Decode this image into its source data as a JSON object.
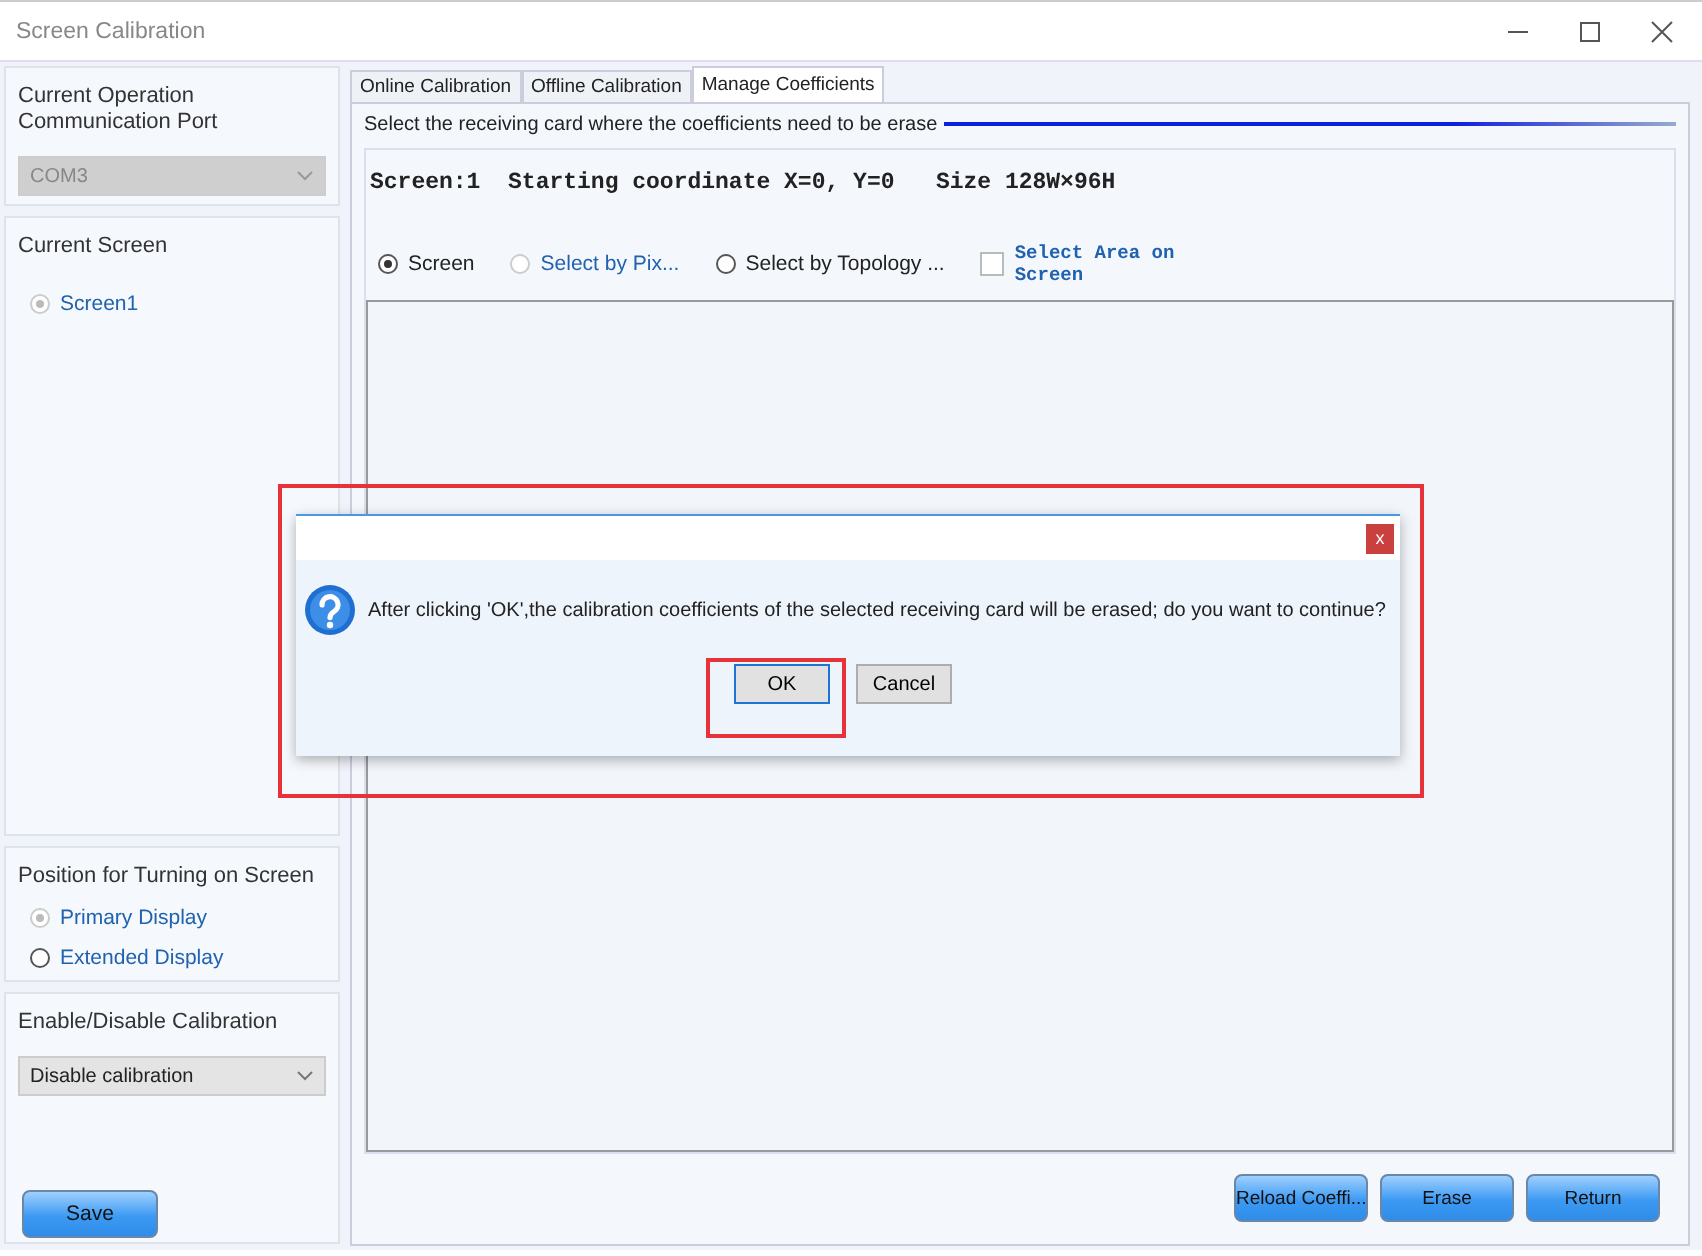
{
  "window": {
    "title": "Screen Calibration"
  },
  "port_group": {
    "legend": "Current Operation Communication Port",
    "value": "COM3",
    "disabled": true
  },
  "screen_group": {
    "legend": "Current Screen",
    "options": [
      {
        "label": "Screen1",
        "selected": true,
        "disabled": true
      }
    ]
  },
  "position_group": {
    "legend": "Position for Turning on Screen",
    "options": [
      {
        "label": "Primary Display",
        "selected": true,
        "disabled": true
      },
      {
        "label": "Extended Display",
        "selected": false,
        "disabled": false
      }
    ]
  },
  "calibration_group": {
    "legend": "Enable/Disable Calibration",
    "value": "Disable calibration",
    "save": "Save"
  },
  "tabs": [
    {
      "label": "Online Calibration",
      "selected": false
    },
    {
      "label": "Offline Calibration",
      "selected": false
    },
    {
      "label": "Manage Coefficients",
      "selected": true
    }
  ],
  "instruction": "Select the receiving card where the coefficients need to be erase",
  "screen_info": "Screen:1  Starting coordinate X=0, Y=0   Size 128W×96H",
  "selection": [
    {
      "kind": "radio",
      "label": "Screen",
      "selected": true,
      "disabled": false
    },
    {
      "kind": "radio",
      "label": "Select by Pix...",
      "selected": false,
      "disabled": true
    },
    {
      "kind": "radio",
      "label": "Select by Topology ...",
      "selected": false,
      "disabled": false
    },
    {
      "kind": "checkbox",
      "label": "Select Area on Screen",
      "checked": false
    }
  ],
  "buttons": [
    "Reload Coeffi...",
    "Erase",
    "Return"
  ],
  "dialog": {
    "message": "After clicking 'OK',the calibration coefficients of the selected receiving card will be erased; do you want to continue?",
    "close": "x",
    "buttons": [
      {
        "label": "OK",
        "focused": true
      },
      {
        "label": "Cancel",
        "focused": false
      }
    ]
  }
}
